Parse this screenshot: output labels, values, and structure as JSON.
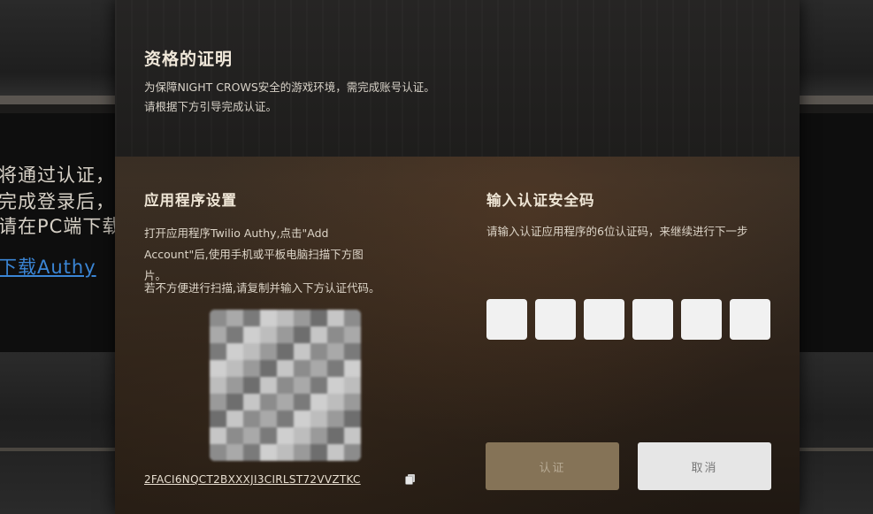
{
  "background": {
    "line1": "将通过认证，来",
    "line2": "完成登录后，请",
    "line3": "请在PC端下载",
    "link": "下载Authy"
  },
  "modal": {
    "title": "资格的证明",
    "subtitle_line1": "为保障NIGHT CROWS安全的游戏环境，需完成账号认证。",
    "subtitle_line2": "请根据下方引导完成认证。",
    "app_setup": {
      "title": "应用程序设置",
      "instruction": "打开应用程序Twilio Authy,点击\"Add Account\"后,使用手机或平板电脑扫描下方图片。",
      "alt_instruction": "若不方便进行扫描,请复制并输入下方认证代码。",
      "secret_code": "2FACI6NQCT2BXXXJI3CIRLST72VVZTKC"
    },
    "verify": {
      "title": "输入认证安全码",
      "instruction": "请输入认证应用程序的6位认证码，来继续进行下一步",
      "digits": [
        "",
        "",
        "",
        "",
        "",
        ""
      ]
    },
    "buttons": {
      "confirm": "认证",
      "cancel": "取消"
    }
  }
}
